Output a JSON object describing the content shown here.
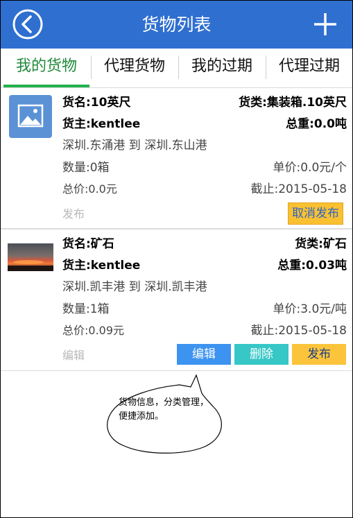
{
  "header": {
    "title": "货物列表"
  },
  "tabs": [
    "我的货物",
    "代理货物",
    "我的过期",
    "代理过期"
  ],
  "items": [
    {
      "name": "货名:10英尺",
      "category": "货类:集装箱.10英尺",
      "owner": "货主:kentlee",
      "weight": "总重:0.0吨",
      "route": "深圳.东涌港 到  深圳.东山港",
      "quantity": "数量:0箱",
      "unit_price": "单价:0.0元/个",
      "total": "总价:0.0元",
      "deadline": "截止:2015-05-18",
      "status": "发布",
      "action": "取消发布"
    },
    {
      "name": "货名:矿石",
      "category": "货类:矿石",
      "owner": "货主:kentlee",
      "weight": "总重:0.03吨",
      "route": "深圳.凯丰港 到  深圳.凯丰港",
      "quantity": "数量:1箱",
      "unit_price": "单价:3.0元/吨",
      "total": "总价:0.09元",
      "deadline": "截止:2015-05-18",
      "status": "编辑",
      "actions": [
        "编辑",
        "删除",
        "发布"
      ]
    }
  ],
  "callout": {
    "text": "货物信息，分类管理，便捷添加。"
  },
  "colors": {
    "header": "#2f6fd0",
    "tab_active": "#22b24c",
    "btn_yellow": "#f9c131",
    "btn_blue": "#3c93f0",
    "btn_teal": "#36c7c6"
  }
}
